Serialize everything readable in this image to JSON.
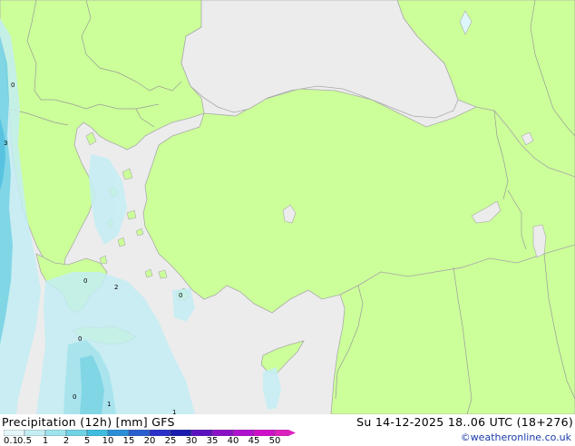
{
  "legend": {
    "title": "Precipitation (12h) [mm] GFS",
    "datetime": "Su 14-12-2025 18..06 UTC (18+276)",
    "credit": "©weatheronline.co.uk",
    "scale": [
      {
        "label": "0.1",
        "color": "#e6f7fa"
      },
      {
        "label": "0.5",
        "color": "#c4eef4"
      },
      {
        "label": "1",
        "color": "#9ee3ee"
      },
      {
        "label": "2",
        "color": "#6fd3e6"
      },
      {
        "label": "5",
        "color": "#3fbde0"
      },
      {
        "label": "10",
        "color": "#2a8fd8"
      },
      {
        "label": "15",
        "color": "#2a5ed0"
      },
      {
        "label": "20",
        "color": "#2a30c8"
      },
      {
        "label": "25",
        "color": "#1a1ab0"
      },
      {
        "label": "30",
        "color": "#5a10c0"
      },
      {
        "label": "35",
        "color": "#8a10c8"
      },
      {
        "label": "40",
        "color": "#b010d0"
      },
      {
        "label": "45",
        "color": "#d010c8"
      },
      {
        "label": "50",
        "color": "#e020c0"
      }
    ]
  },
  "map": {
    "land_color": "#ccff99",
    "sea_color": "#ececec",
    "border_color": "#aaaaaa",
    "point_labels": [
      "0",
      "3",
      "0",
      "2",
      "0",
      "0",
      "0",
      "1",
      "1"
    ]
  }
}
